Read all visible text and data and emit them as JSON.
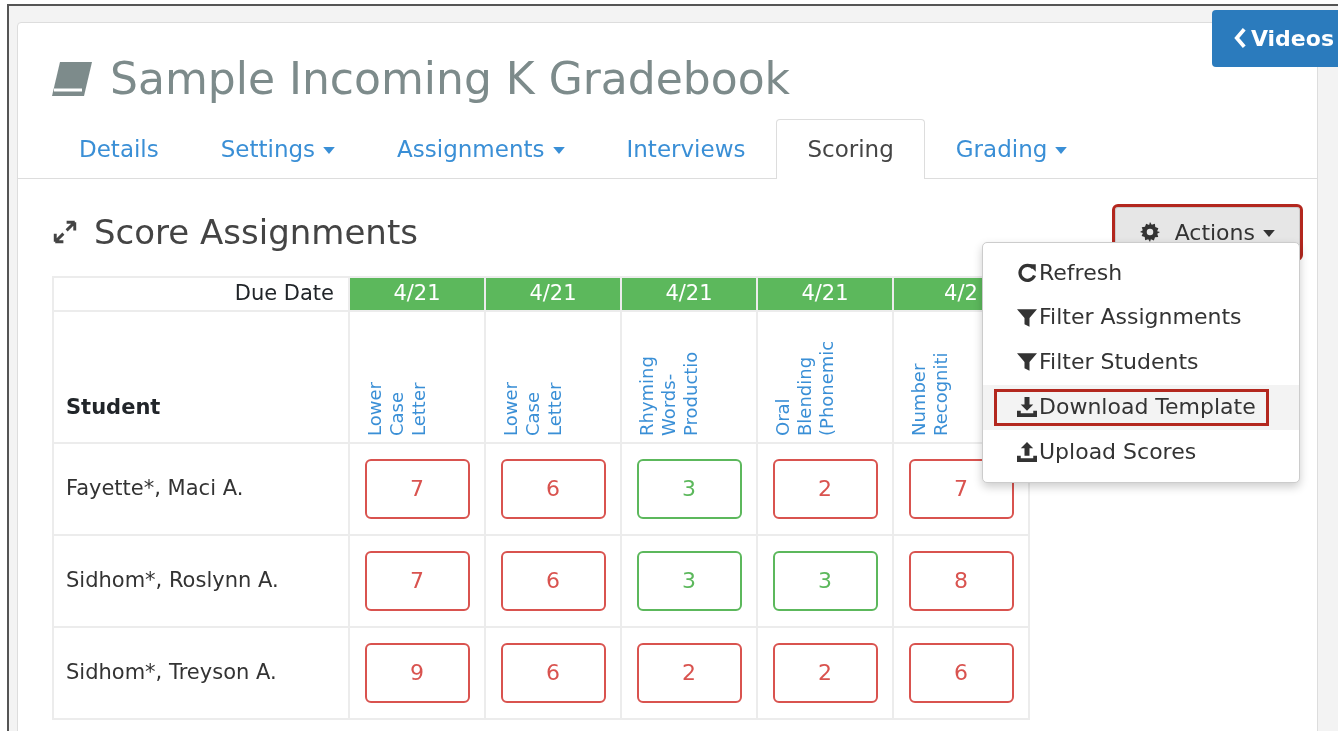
{
  "videos_button": {
    "label": "Videos"
  },
  "title": "Sample Incoming K Gradebook",
  "tabs": [
    {
      "label": "Details",
      "dropdown": false,
      "selected": false
    },
    {
      "label": "Settings",
      "dropdown": true,
      "selected": false
    },
    {
      "label": "Assignments",
      "dropdown": true,
      "selected": false
    },
    {
      "label": "Interviews",
      "dropdown": false,
      "selected": false
    },
    {
      "label": "Scoring",
      "dropdown": false,
      "selected": true
    },
    {
      "label": "Grading",
      "dropdown": true,
      "selected": false
    }
  ],
  "section_title": "Score Assignments",
  "actions_button": {
    "label": "Actions",
    "highlighted": true
  },
  "actions_menu": [
    {
      "label": "Refresh",
      "kind": "refresh",
      "highlighted": false
    },
    {
      "label": "Filter Assignments",
      "kind": "filter",
      "highlighted": false
    },
    {
      "label": "Filter Students",
      "kind": "filter",
      "highlighted": false
    },
    {
      "label": "Download Template",
      "kind": "download",
      "highlighted": true
    },
    {
      "label": "Upload Scores",
      "kind": "upload",
      "highlighted": false
    }
  ],
  "table": {
    "due_date_label": "Due Date",
    "student_header": "Student",
    "columns": [
      {
        "due": "4/21",
        "name": "Lower Case Letter"
      },
      {
        "due": "4/21",
        "name": "Lower Case Letter"
      },
      {
        "due": "4/21",
        "name": "Rhyming Words- Productio"
      },
      {
        "due": "4/21",
        "name": "Oral Blending (Phonemic"
      },
      {
        "due": "4/2",
        "name": "Number Recogniti"
      }
    ],
    "rows": [
      {
        "student": "Fayette*, Maci A.",
        "scores": [
          {
            "value": "7",
            "color": "#d9534f"
          },
          {
            "value": "6",
            "color": "#d9534f"
          },
          {
            "value": "3",
            "color": "#5cb85c"
          },
          {
            "value": "2",
            "color": "#d9534f"
          },
          {
            "value": "7",
            "color": "#d9534f"
          }
        ]
      },
      {
        "student": "Sidhom*, Roslynn A.",
        "scores": [
          {
            "value": "7",
            "color": "#d9534f"
          },
          {
            "value": "6",
            "color": "#d9534f"
          },
          {
            "value": "3",
            "color": "#5cb85c"
          },
          {
            "value": "3",
            "color": "#5cb85c"
          },
          {
            "value": "8",
            "color": "#d9534f"
          }
        ]
      },
      {
        "student": "Sidhom*, Treyson A.",
        "scores": [
          {
            "value": "9",
            "color": "#d9534f"
          },
          {
            "value": "6",
            "color": "#d9534f"
          },
          {
            "value": "2",
            "color": "#d9534f"
          },
          {
            "value": "2",
            "color": "#d9534f"
          },
          {
            "value": "6",
            "color": "#d9534f"
          }
        ]
      }
    ]
  }
}
